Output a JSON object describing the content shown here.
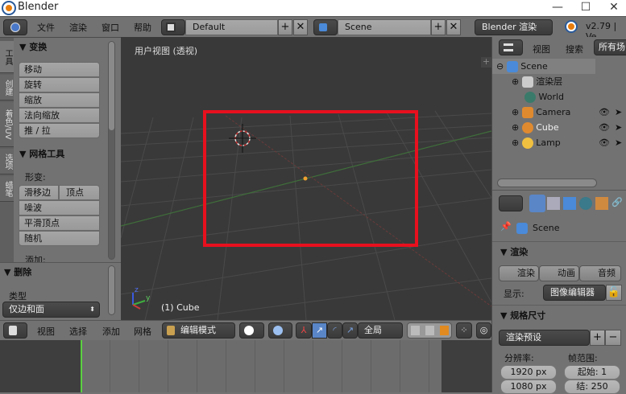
{
  "window": {
    "title": "Blender",
    "minimize": "—",
    "maximize": "☐",
    "close": "✕"
  },
  "topbar": {
    "menus": [
      "文件",
      "渲染",
      "窗口",
      "帮助"
    ],
    "layout": "Default",
    "scene": "Scene",
    "engine": "Blender 渲染",
    "version": "v2.79 | Ve"
  },
  "left_tabs": [
    "工具",
    "创建",
    "着色/UV",
    "选项",
    "蜡笔"
  ],
  "toolshelf": {
    "transform": {
      "title": "变换",
      "buttons": [
        "移动",
        "旋转",
        "缩放",
        "法向缩放",
        "推 / 拉"
      ]
    },
    "mesh_tools": {
      "title": "网格工具",
      "deform_label": "形变:",
      "slide_edge": "滑移边",
      "vertex": "顶点",
      "buttons": [
        "噪波",
        "平滑顶点",
        "随机"
      ],
      "add_label": "添加:"
    },
    "delete": {
      "title": "删除",
      "type_label": "类型",
      "type_value": "仅边和面"
    }
  },
  "viewport": {
    "view_label": "用户视图 (透视)",
    "object_label": "(1) Cube",
    "axis_z": "z",
    "axis_y": "y",
    "highlight_color": "#e8101e"
  },
  "viewport_header": {
    "menus": [
      "视图",
      "选择",
      "添加",
      "网格"
    ],
    "mode": "编辑模式",
    "pivot": "全局"
  },
  "outliner": {
    "tabs": [
      "视图",
      "搜索",
      "所有场"
    ],
    "items": [
      {
        "label": "Scene"
      },
      {
        "label": "渲染层"
      },
      {
        "label": "World"
      },
      {
        "label": "Camera"
      },
      {
        "label": "Cube"
      },
      {
        "label": "Lamp"
      }
    ]
  },
  "properties": {
    "context": "Scene",
    "render": {
      "title": "渲染",
      "buttons": [
        "渲染",
        "动画",
        "音频"
      ],
      "display_label": "显示:",
      "display_value": "图像编辑器"
    },
    "dimensions": {
      "title": "规格尺寸",
      "preset": "渲染预设",
      "resolution_label": "分辨率:",
      "res_x": "1920 px",
      "res_y": "1080 px",
      "frame_range_label": "帧范围:",
      "start": "起始:  1",
      "end": "结:  250"
    }
  }
}
